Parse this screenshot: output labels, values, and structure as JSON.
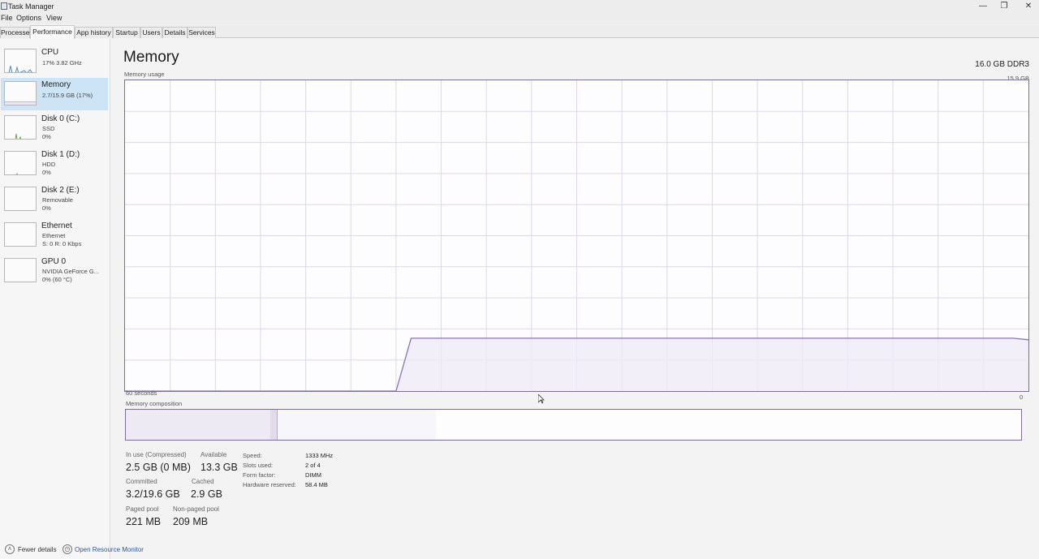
{
  "window": {
    "title": "Task Manager",
    "minimize": "—",
    "restore": "❐",
    "close": "✕"
  },
  "menu": [
    "File",
    "Options",
    "View"
  ],
  "tabs": [
    {
      "label": "Processes",
      "active": false
    },
    {
      "label": "Performance",
      "active": true
    },
    {
      "label": "App history",
      "active": false
    },
    {
      "label": "Startup",
      "active": false
    },
    {
      "label": "Users",
      "active": false
    },
    {
      "label": "Details",
      "active": false
    },
    {
      "label": "Services",
      "active": false
    }
  ],
  "sidebar": [
    {
      "title": "CPU",
      "lines": [
        "17% 3.82 GHz"
      ],
      "active": false
    },
    {
      "title": "Memory",
      "lines": [
        "2.7/15.9 GB (17%)"
      ],
      "active": true
    },
    {
      "title": "Disk 0 (C:)",
      "lines": [
        "SSD",
        "0%"
      ],
      "active": false
    },
    {
      "title": "Disk 1 (D:)",
      "lines": [
        "HDD",
        "0%"
      ],
      "active": false
    },
    {
      "title": "Disk 2 (E:)",
      "lines": [
        "Removable",
        "0%"
      ],
      "active": false
    },
    {
      "title": "Ethernet",
      "lines": [
        "Ethernet",
        "S: 0 R: 0 Kbps"
      ],
      "active": false
    },
    {
      "title": "GPU 0",
      "lines": [
        "NVIDIA GeForce G...",
        "0% (60 °C)"
      ],
      "active": false
    }
  ],
  "main": {
    "title": "Memory",
    "spec": "16.0 GB DDR3",
    "usage_label": "Memory usage",
    "usage_max": "15.9 GB",
    "time_label": "60 seconds",
    "zero_label": "0",
    "composition_label": "Memory composition"
  },
  "stats": {
    "in_use_label": "In use (Compressed)",
    "in_use_value": "2.5 GB (0 MB)",
    "available_label": "Available",
    "available_value": "13.3 GB",
    "committed_label": "Committed",
    "committed_value": "3.2/19.6 GB",
    "cached_label": "Cached",
    "cached_value": "2.9 GB",
    "paged_label": "Paged pool",
    "paged_value": "221 MB",
    "nonpaged_label": "Non-paged pool",
    "nonpaged_value": "209 MB"
  },
  "specs": [
    {
      "label": "Speed:",
      "value": "1333 MHz"
    },
    {
      "label": "Slots used:",
      "value": "2 of 4"
    },
    {
      "label": "Form factor:",
      "value": "DIMM"
    },
    {
      "label": "Hardware reserved:",
      "value": "58.4 MB"
    }
  ],
  "footer": {
    "fewer_details": "Fewer details",
    "open_monitor": "Open Resource Monitor"
  },
  "chart_data": {
    "type": "area",
    "x_range_seconds": [
      60,
      0
    ],
    "y_range_gb": [
      0,
      15.9
    ],
    "series": [
      {
        "values_percent": [
          0,
          0,
          0,
          0,
          0,
          0,
          0,
          0,
          0,
          0,
          0,
          0,
          0,
          0,
          0,
          0,
          0,
          0,
          0,
          17,
          17,
          17,
          17,
          17,
          17,
          17,
          17,
          17,
          17,
          17,
          17,
          17,
          17,
          17,
          17,
          17,
          17,
          17,
          17,
          17,
          17,
          17,
          17,
          17,
          17,
          17,
          17,
          17,
          17,
          17,
          17,
          17,
          17,
          17,
          17,
          17,
          17,
          17,
          17,
          17,
          16.5
        ]
      }
    ],
    "grid": true,
    "colors": {
      "line": "#8a74b3",
      "fill": "#efebf5",
      "grid": "#ded8ea"
    }
  }
}
